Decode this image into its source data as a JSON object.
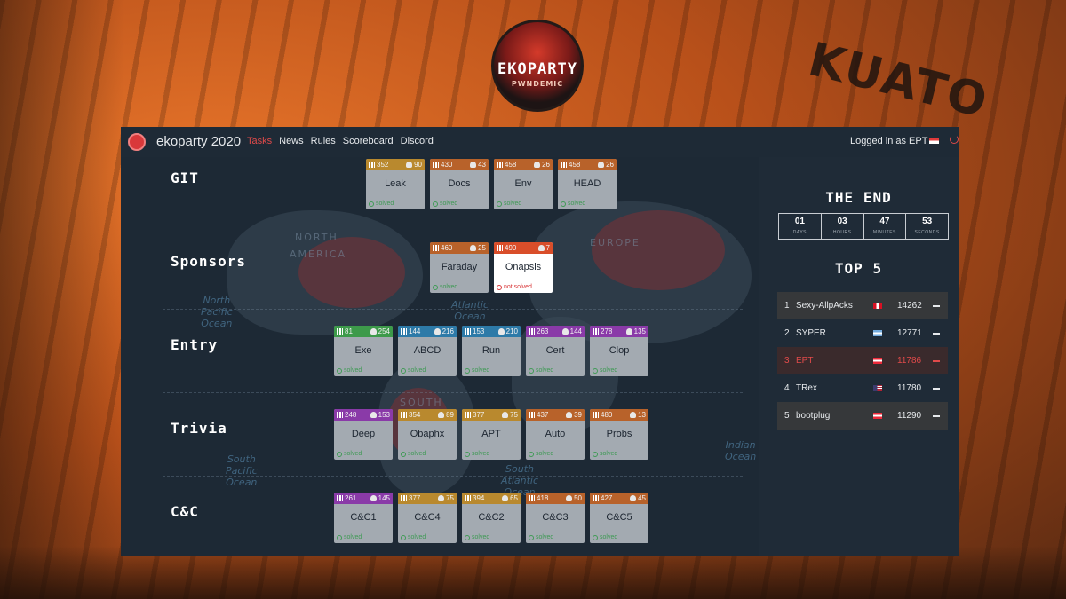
{
  "background": {
    "graffiti": "KUATO"
  },
  "logo": {
    "main": "EKOPARTY",
    "sub": "PWNDEMIC"
  },
  "header": {
    "brand": "ekoparty 2020",
    "nav": [
      "Tasks",
      "News",
      "Rules",
      "Scoreboard",
      "Discord"
    ],
    "active_nav": "Tasks",
    "login_text": "Logged in as EPT"
  },
  "map_labels": {
    "continents": [
      "NORTH",
      "AMERICA",
      "EUROPE",
      "SOUTH"
    ],
    "oceans": [
      "North\nPacific\nOcean",
      "South\nPacific\nOcean",
      "South\nAtlantic\nOcean",
      "Indian\nOcean",
      "Atlantic\nOcean"
    ]
  },
  "categories": [
    {
      "name": "GIT",
      "tasks": [
        {
          "name": "Leak",
          "points": "352",
          "solves": "90",
          "status": "solved",
          "color": "#b9892e"
        },
        {
          "name": "Docs",
          "points": "430",
          "solves": "43",
          "status": "solved",
          "color": "#b8622a"
        },
        {
          "name": "Env",
          "points": "458",
          "solves": "26",
          "status": "solved",
          "color": "#b8622a"
        },
        {
          "name": "HEAD",
          "points": "458",
          "solves": "26",
          "status": "solved",
          "color": "#b8622a"
        }
      ]
    },
    {
      "name": "Sponsors",
      "tasks": [
        {
          "name": "Faraday",
          "points": "460",
          "solves": "25",
          "status": "solved",
          "color": "#b8622a"
        },
        {
          "name": "Onapsis",
          "points": "490",
          "solves": "7",
          "status": "not solved",
          "color": "#d94e2a"
        }
      ]
    },
    {
      "name": "Entry",
      "tasks": [
        {
          "name": "Exe",
          "points": "81",
          "solves": "254",
          "status": "solved",
          "color": "#3d9a4a"
        },
        {
          "name": "ABCD",
          "points": "144",
          "solves": "216",
          "status": "solved",
          "color": "#2d7aa8"
        },
        {
          "name": "Run",
          "points": "153",
          "solves": "210",
          "status": "solved",
          "color": "#2d7aa8"
        },
        {
          "name": "Cert",
          "points": "263",
          "solves": "144",
          "status": "solved",
          "color": "#8a3aa8"
        },
        {
          "name": "Clop",
          "points": "278",
          "solves": "135",
          "status": "solved",
          "color": "#8a3aa8"
        }
      ]
    },
    {
      "name": "Trivia",
      "tasks": [
        {
          "name": "Deep",
          "points": "248",
          "solves": "153",
          "status": "solved",
          "color": "#8a3aa8"
        },
        {
          "name": "Obaphx",
          "points": "354",
          "solves": "89",
          "status": "solved",
          "color": "#b9892e"
        },
        {
          "name": "APT",
          "points": "377",
          "solves": "75",
          "status": "solved",
          "color": "#b9892e"
        },
        {
          "name": "Auto",
          "points": "437",
          "solves": "39",
          "status": "solved",
          "color": "#b8622a"
        },
        {
          "name": "Probs",
          "points": "480",
          "solves": "13",
          "status": "solved",
          "color": "#b8622a"
        }
      ]
    },
    {
      "name": "C&C",
      "tasks": [
        {
          "name": "C&C1",
          "points": "261",
          "solves": "145",
          "status": "solved",
          "color": "#8a3aa8"
        },
        {
          "name": "C&C4",
          "points": "377",
          "solves": "75",
          "status": "solved",
          "color": "#b9892e"
        },
        {
          "name": "C&C2",
          "points": "394",
          "solves": "65",
          "status": "solved",
          "color": "#b9892e"
        },
        {
          "name": "C&C3",
          "points": "418",
          "solves": "50",
          "status": "solved",
          "color": "#b8622a"
        },
        {
          "name": "C&C5",
          "points": "427",
          "solves": "45",
          "status": "solved",
          "color": "#b8622a"
        }
      ]
    }
  ],
  "sidebar": {
    "countdown_title": "THE END",
    "countdown": [
      {
        "value": "01",
        "label": "DAYS"
      },
      {
        "value": "03",
        "label": "HOURS"
      },
      {
        "value": "47",
        "label": "MINUTES"
      },
      {
        "value": "53",
        "label": "SECONDS"
      }
    ],
    "top_title": "TOP 5",
    "top": [
      {
        "rank": "1",
        "name": "Sexy-AllpAcks",
        "score": "14262",
        "flag": "peru-flag"
      },
      {
        "rank": "2",
        "name": "SYPER",
        "score": "12771",
        "flag": "argentina-flag"
      },
      {
        "rank": "3",
        "name": "EPT",
        "score": "11786",
        "flag": "austria-flag",
        "highlight": true
      },
      {
        "rank": "4",
        "name": "TRex",
        "score": "11780",
        "flag": "usa-flag"
      },
      {
        "rank": "5",
        "name": "bootplug",
        "score": "11290",
        "flag": "austria-flag"
      }
    ]
  }
}
